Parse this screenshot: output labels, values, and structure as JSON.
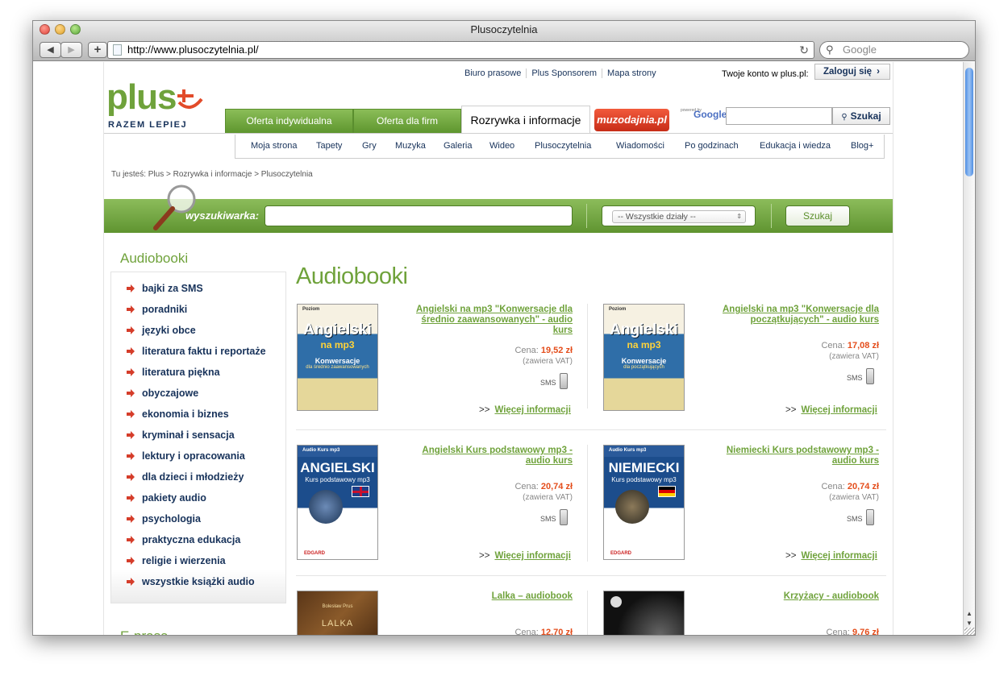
{
  "browser": {
    "title": "Plusoczytelnia",
    "url": "http://www.plusoczytelnia.pl/",
    "search_placeholder": "Google",
    "back": "◀",
    "forward": "▶",
    "add": "+",
    "reload": "↻"
  },
  "header": {
    "top_links": [
      "Biuro prasowe",
      "Plus Sponsorem",
      "Mapa strony"
    ],
    "account_text": "Twoje konto w plus.pl:",
    "login_button": "Zaloguj się",
    "logo_text": "plus",
    "logo_tagline": "RAZEM LEPIEJ",
    "tabs": [
      "Oferta indywidualna",
      "Oferta dla firm",
      "Rozrywka i informacje"
    ],
    "muzodajnia": "muzodajnia.pl",
    "google_powered": "powered by",
    "google_logo": "Google",
    "google_search_button": "Szukaj",
    "subnav": [
      "Moja strona",
      "Tapety",
      "Gry",
      "Muzyka",
      "Galeria",
      "Wideo",
      "Plusoczytelnia",
      "Wiadomości",
      "Po godzinach",
      "Edukacja i wiedza",
      "Blog+"
    ]
  },
  "breadcrumb": "Tu jesteś: Plus > Rozrywka i informacje > Plusoczytelnia",
  "search": {
    "label": "wyszukiwarka:",
    "input_value": "",
    "select_value": "-- Wszystkie działy --",
    "button": "Szukaj"
  },
  "sidebar": {
    "heading": "Audiobooki",
    "items": [
      "bajki za SMS",
      "poradniki",
      "języki obce",
      "literatura faktu i reportaże",
      "literatura piękna",
      "obyczajowe",
      "ekonomia i biznes",
      "kryminał i sensacja",
      "lektury i opracowania",
      "dla dzieci i młodzieży",
      "pakiety audio",
      "psychologia",
      "praktyczna edukacja",
      "religie i wierzenia",
      "wszystkie książki audio"
    ],
    "next_heading": "E-prasa"
  },
  "main": {
    "heading": "Audiobooki",
    "price_label": "Cena:",
    "vat_label": "(zawiera VAT)",
    "sms_label": "SMS",
    "more_arrow": ">>",
    "more_label": "Więcej informacji",
    "products": [
      {
        "title": "Angielski na mp3 \"Konwersacje dla średnio zaawansowanych\" - audio kurs",
        "price": "19,52 zł",
        "cover": {
          "top": "Poziom",
          "big": "Angielski",
          "mp3": "na mp3",
          "sub": "Konwersacje",
          "sub2": "dla średnio zaawansowanych"
        }
      },
      {
        "title": "Angielski na mp3 \"Konwersacje dla początkujących\" - audio kurs",
        "price": "17,08 zł",
        "cover": {
          "top": "Poziom",
          "big": "Angielski",
          "mp3": "na mp3",
          "sub": "Konwersacje",
          "sub2": "dla początkujących"
        }
      },
      {
        "title": "Angielski Kurs podstawowy mp3 - audio kurs",
        "price": "20,74 zł",
        "cover": {
          "top": "Audio Kurs mp3",
          "big": "ANGIELSKI",
          "sub": "Kurs podstawowy mp3",
          "brand": "EDGARD"
        }
      },
      {
        "title": "Niemiecki Kurs podstawowy mp3 - audio kurs",
        "price": "20,74 zł",
        "cover": {
          "top": "Audio Kurs mp3",
          "big": "NIEMIECKI",
          "sub": "Kurs podstawowy mp3",
          "brand": "EDGARD"
        }
      },
      {
        "title": "Lalka – audiobook",
        "price": "12,70 zł",
        "cover": {
          "top": "Bolesław Prus",
          "big": "LALKA"
        }
      },
      {
        "title": "Krzyżacy - audiobook",
        "price": "9,76 zł",
        "cover": {
          "top": "",
          "big": ""
        }
      }
    ]
  },
  "colors": {
    "green": "#6fa23b",
    "navy": "#17325a",
    "price": "#e44d1b",
    "arrow": "#d53d2a"
  }
}
